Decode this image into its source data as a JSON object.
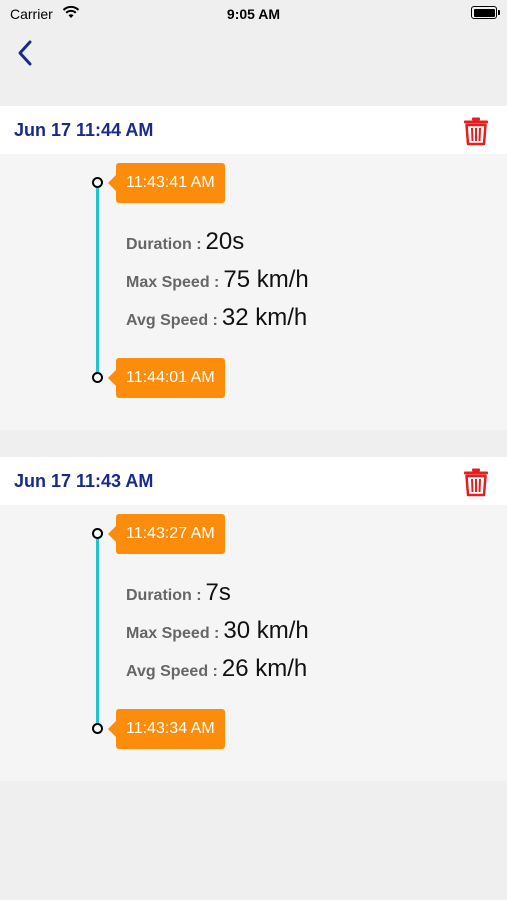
{
  "status_bar": {
    "carrier": "Carrier",
    "time": "9:05 AM"
  },
  "colors": {
    "title": "#1a2a8c",
    "time_tag": "#fb8c0c",
    "timeline": "#22c3cc",
    "trash": "#e61e1e"
  },
  "trips": [
    {
      "title": "Jun 17 11:44 AM",
      "start_time": "11:43:41 AM",
      "end_time": "11:44:01 AM",
      "duration_label": "Duration :",
      "duration_value": "20s",
      "max_speed_label": "Max Speed :",
      "max_speed_value": "75 km/h",
      "avg_speed_label": "Avg Speed :",
      "avg_speed_value": "32 km/h"
    },
    {
      "title": "Jun 17 11:43 AM",
      "start_time": "11:43:27 AM",
      "end_time": "11:43:34 AM",
      "duration_label": "Duration :",
      "duration_value": "7s",
      "max_speed_label": "Max Speed :",
      "max_speed_value": "30 km/h",
      "avg_speed_label": "Avg Speed :",
      "avg_speed_value": "26 km/h"
    }
  ]
}
